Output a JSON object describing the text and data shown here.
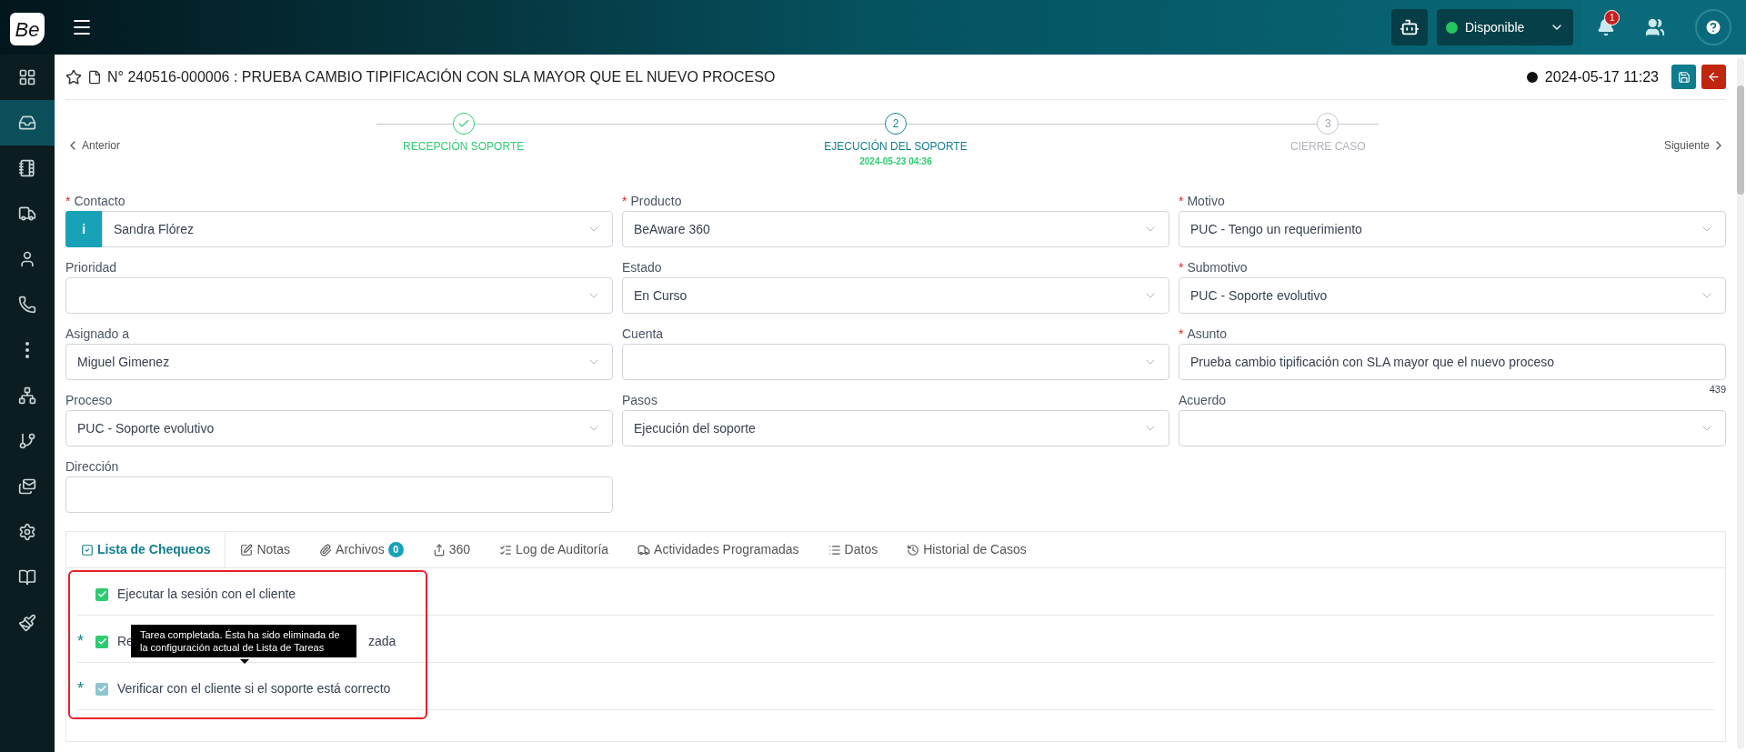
{
  "topbar": {
    "logo": "Be",
    "status": {
      "label": "Disponible",
      "color": "#22c55e"
    },
    "notifications": "1"
  },
  "sidebar": {
    "items": [
      {
        "selected": false
      },
      {
        "selected": true
      },
      {
        "selected": false
      },
      {
        "selected": false
      },
      {
        "selected": false
      },
      {
        "selected": false
      },
      {
        "selected": false
      },
      {
        "selected": false
      },
      {
        "selected": false
      },
      {
        "selected": false
      },
      {
        "selected": false
      },
      {
        "selected": false
      },
      {
        "selected": false
      }
    ]
  },
  "header": {
    "title": "N° 240516-000006 : PRUEBA CAMBIO TIPIFICACIÓN CON SLA MAYOR QUE EL NUEVO PROCESO",
    "datetime": "2024-05-17 11:23"
  },
  "stepper": {
    "previous": "Anterior",
    "next": "Siguiente",
    "steps": [
      {
        "label": "RECEPCIÓN SOPORTE",
        "completed": true,
        "current": false
      },
      {
        "number": "2",
        "label": "EJECUCIÓN DEL SOPORTE",
        "date": "2024-05-23 04:36",
        "completed": false,
        "current": true
      },
      {
        "number": "3",
        "label": "CIERRE CASO",
        "completed": false,
        "current": false
      }
    ]
  },
  "form": {
    "fields": [
      {
        "label": "Contacto",
        "required_mark": "*",
        "kind": "select",
        "value": "Sandra Flórez",
        "info_button": "i"
      },
      {
        "label": "Producto",
        "required_mark": "*",
        "kind": "select",
        "value": "BeAware 360"
      },
      {
        "label": "Motivo",
        "required_mark": "*",
        "kind": "select",
        "value": "PUC - Tengo un requerimiento"
      },
      {
        "label": "Prioridad",
        "kind": "select"
      },
      {
        "label": "Estado",
        "kind": "select",
        "value": "En Curso"
      },
      {
        "label": "Submotivo",
        "required_mark": "*",
        "kind": "select",
        "value": "PUC - Soporte evolutivo"
      },
      {
        "label": "Asignado a",
        "kind": "select",
        "value": "Miguel Gimenez"
      },
      {
        "label": "Cuenta",
        "kind": "select"
      },
      {
        "label": "Asunto",
        "required_mark": "*",
        "kind": "text",
        "value": "Prueba cambio tipificación con SLA mayor que el nuevo proceso",
        "counter": "439"
      },
      {
        "label": "Proceso",
        "kind": "select",
        "value": "PUC - Soporte evolutivo"
      },
      {
        "label": "Pasos",
        "kind": "select",
        "value": "Ejecución del soporte"
      },
      {
        "label": "Acuerdo",
        "kind": "select"
      },
      {
        "label": "Dirección",
        "kind": "text"
      }
    ]
  },
  "tabs": [
    {
      "label": "Lista de Chequeos",
      "selected": true
    },
    {
      "label": "Notas",
      "selected": false
    },
    {
      "label": "Archivos",
      "selected": false,
      "badge": "0"
    },
    {
      "label": "360",
      "selected": false
    },
    {
      "label": "Log de Auditoría",
      "selected": false
    },
    {
      "label": "Actividades Programadas",
      "selected": false
    },
    {
      "label": "Datos",
      "selected": false
    },
    {
      "label": "Historial de Casos",
      "selected": false
    }
  ],
  "checklist": [
    {
      "text_parts": [
        "Ejecutar la sesión con el cliente"
      ],
      "checked": true,
      "disabled": false
    },
    {
      "mark": "*",
      "text_parts": [
        "Re",
        "zada"
      ],
      "checked": true,
      "disabled": false
    },
    {
      "mark": "*",
      "text_parts": [
        "Verificar con el cliente si el soporte está correcto"
      ],
      "checked": true,
      "disabled": true
    }
  ],
  "tooltip": "Tarea completada. Ésta ha sido eliminada de la configuración actual de Lista de Tareas"
}
